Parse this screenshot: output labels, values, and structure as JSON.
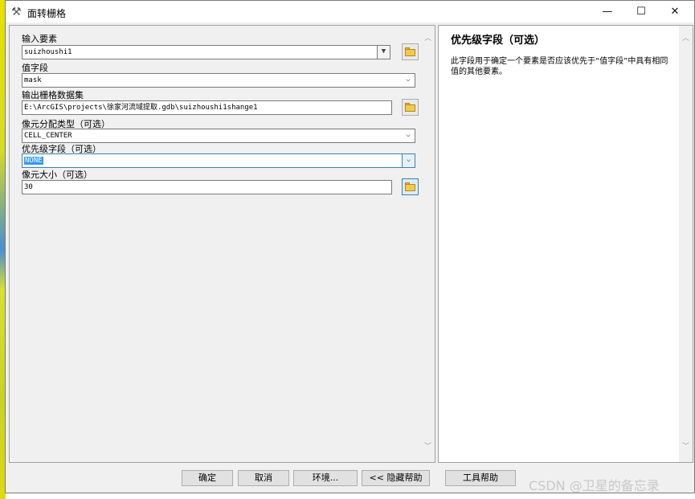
{
  "window": {
    "title": "面转栅格",
    "minimize": "—",
    "maximize": "☐",
    "close": "✕"
  },
  "form": {
    "input_features": {
      "label": "输入要素",
      "value": "suizhoushi1"
    },
    "value_field": {
      "label": "值字段",
      "value": "mask"
    },
    "output_raster": {
      "label": "输出栅格数据集",
      "value": "E:\\ArcGIS\\projects\\徐家河流域提取.gdb\\suizhoushi1shange1"
    },
    "cell_assignment": {
      "label": "像元分配类型（可选）",
      "value": "CELL_CENTER"
    },
    "priority_field": {
      "label": "优先级字段（可选）",
      "value": "NONE"
    },
    "cell_size": {
      "label": "像元大小（可选）",
      "value": "30"
    }
  },
  "help": {
    "title": "优先级字段（可选）",
    "body": "此字段用于确定一个要素是否应该优先于“值字段”中具有相同值的其他要素。"
  },
  "buttons": {
    "ok": "确定",
    "cancel": "取消",
    "environments": "环境...",
    "hide_help": "<< 隐藏帮助",
    "tool_help": "工具帮助"
  },
  "watermark": "CSDN @卫星的备忘录",
  "colors": {
    "selection": "#3399ff",
    "focus_border": "#3c7fb1",
    "window_bg": "#f0f0f0"
  }
}
